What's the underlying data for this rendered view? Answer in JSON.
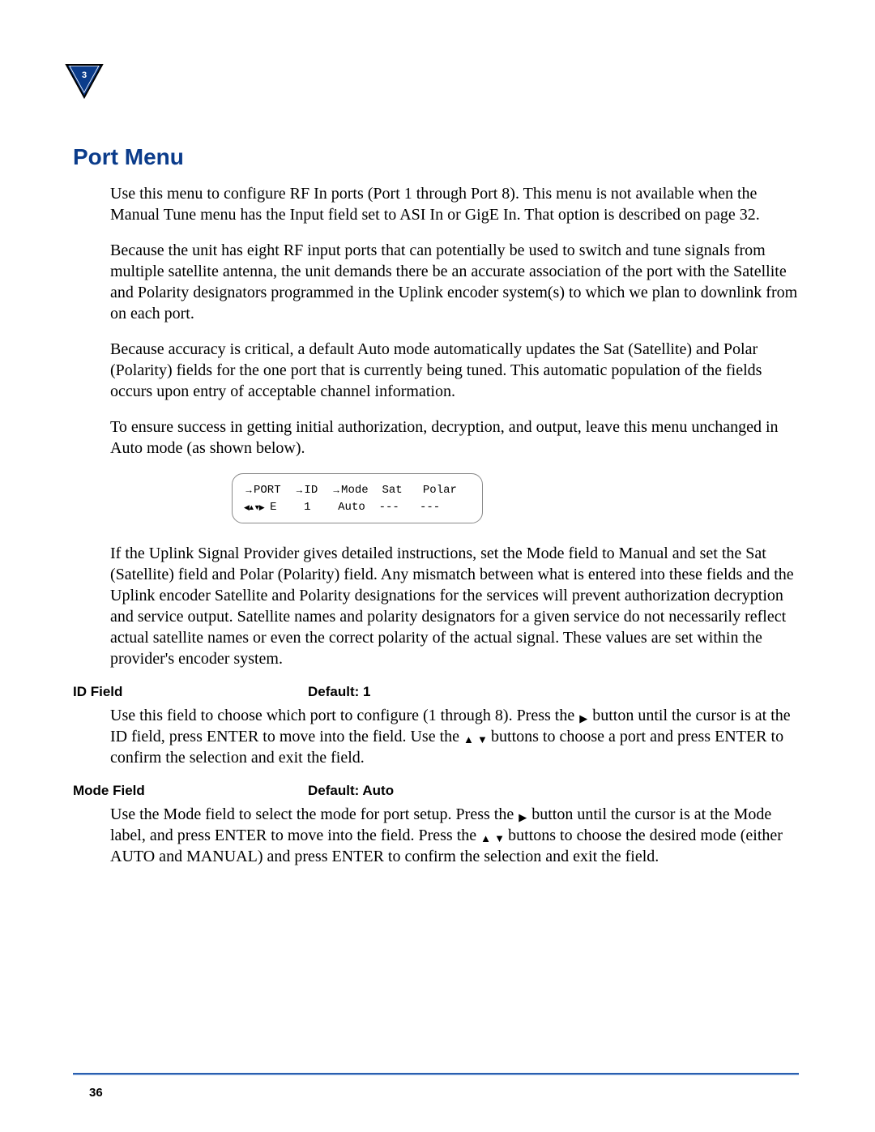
{
  "chapter_number": "3",
  "section_title": "Port Menu",
  "paragraphs": {
    "p1": "Use this menu to configure RF In ports (Port 1 through Port 8). This menu is not available when the Manual Tune menu has the Input field set to ASI In or GigE In. That option is described on page 32.",
    "p2": "Because the unit has eight RF input ports that can potentially be used to switch and tune signals from multiple satellite antenna, the unit demands there be an accurate association of the port with the Satellite and Polarity designators programmed in the Uplink encoder system(s) to which we plan to downlink from on each port.",
    "p3": "Because accuracy is critical, a default Auto mode automatically updates the Sat (Satellite) and Polar (Polarity) fields for the one port that is currently being tuned. This automatic population of the fields occurs upon entry of acceptable channel information.",
    "p4": "To ensure success in getting initial authorization, decryption, and output, leave this menu unchanged in Auto mode (as shown below).",
    "p5": "If the Uplink Signal Provider gives detailed instructions, set the Mode field to Manual and set the Sat (Satellite) field and Polar (Polarity) field. Any mismatch between what is entered into these fields and the Uplink encoder Satellite and Polarity designations for the services will prevent authorization decryption and service output. Satellite names and polarity designators for a given service do not necessarily reflect actual satellite names or even the correct polarity of the actual signal. These values are set within the provider's encoder system."
  },
  "lcd": {
    "row1": {
      "c1": "PORT",
      "c2": "ID",
      "c3": "Mode",
      "c4": "Sat",
      "c5": "Polar"
    },
    "row2": {
      "c1": " E",
      "c2": "1",
      "c3": "Auto",
      "c4": "---",
      "c5": "---"
    }
  },
  "fields": {
    "id": {
      "label": "ID Field",
      "default": "Default: 1",
      "text_a": "Use this field to choose which port to configure (1 through 8). Press the ",
      "text_b": " button until the cursor is at the ID field, press ENTER to move into the field. Use the ",
      "text_c": " buttons to choose a port and press ENTER to confirm the selection and exit the field."
    },
    "mode": {
      "label": "Mode Field",
      "default": "Default: Auto",
      "text_a": "Use the Mode field to select the mode for port setup. Press the ",
      "text_b": " button until the cursor is at the Mode label, and press ENTER to move into the field. Press the ",
      "text_c": " buttons to choose the desired mode (either AUTO and MANUAL) and press ENTER to confirm the selection and exit the field."
    }
  },
  "icons": {
    "right_arrow": "→",
    "nav_arrows": "◀▲▼▶",
    "tri_right": "▶",
    "tri_up": "▲",
    "tri_down": "▼"
  },
  "page_number": "36"
}
